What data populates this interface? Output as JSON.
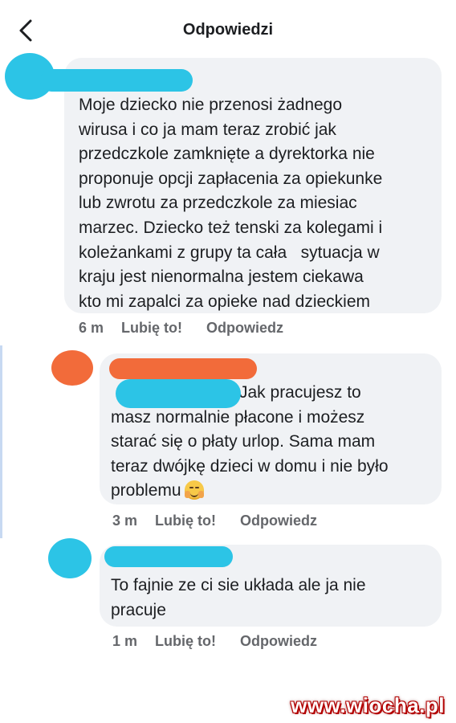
{
  "header": {
    "title": "Odpowiedzi",
    "back_icon": "chevron-left-icon"
  },
  "comments": [
    {
      "text": "Moje dziecko nie przenosi żadnego\nwirusa i co ja mam teraz zrobić jak\nprzedczkole zamknięte a dyrektorka nie\nproponuje opcji zapłacenia za opiekunke\nlub zwrotu za przedczkole za miesiac\nmarzec. Dziecko też tenski za kolegami i\nkoleżankami z grupy ta cała   sytuacja w\nkraju jest nienormalna jestem ciekawa\nkto mi zapalci za opieke nad dzieckiem",
      "time": "6 m",
      "like_label": "Lubię to!",
      "reply_label": "Odpowiedz",
      "redaction_color": "#2cc4e6"
    },
    {
      "text": "Jak pracujesz to\nmasz normalnie płacone i możesz\nstarać się o płaty urlop. Sama mam\nteraz dwójkę dzieci w domu i nie było\nproblemu",
      "emoji": "hugging-face-emoji",
      "time": "3 m",
      "like_label": "Lubię to!",
      "reply_label": "Odpowiedz",
      "redaction_color": "#f26b3a",
      "inline_redaction_color": "#2cc4e6"
    },
    {
      "text": "To fajnie ze ci sie układa ale ja nie\npracuje",
      "time": "1 m",
      "like_label": "Lubię to!",
      "reply_label": "Odpowiedz",
      "redaction_color": "#2cc4e6"
    }
  ],
  "watermark": "www.wiocha.pl"
}
